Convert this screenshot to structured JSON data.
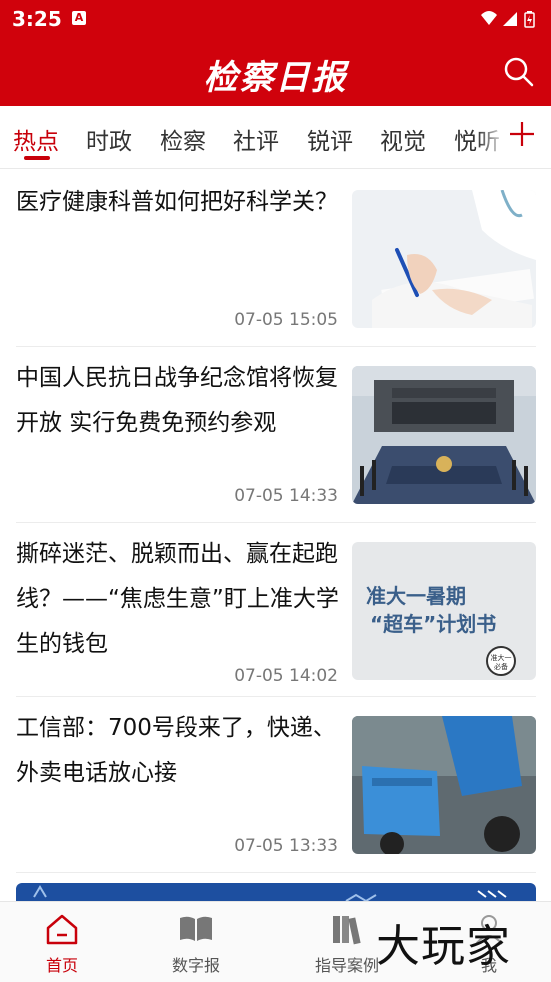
{
  "status_bar": {
    "time": "3:25",
    "notification_icon": "app-notification-icon"
  },
  "header": {
    "logo_text": "检察日报",
    "search_icon": "search-icon"
  },
  "tabs": [
    {
      "label": "热点",
      "active": true
    },
    {
      "label": "时政"
    },
    {
      "label": "检察"
    },
    {
      "label": "社评"
    },
    {
      "label": "锐评"
    },
    {
      "label": "视觉"
    },
    {
      "label": "悦听"
    }
  ],
  "news": [
    {
      "title": "医疗健康科普如何把好科学关？",
      "time": "07-05 15:05",
      "thumb": "doctor-writing-photo"
    },
    {
      "title": "中国人民抗日战争纪念馆将恢复开放 实行免费免预约参观",
      "time": "07-05 14:33",
      "thumb": "memorial-hall-photo"
    },
    {
      "title": "撕碎迷茫、脱颖而出、赢在起跑线？——“焦虑生意”盯上准大学生的钱包",
      "time": "07-05 14:02",
      "thumb": "poster-image"
    },
    {
      "title": "工信部：700号段来了，快递、外卖电话放心接",
      "time": "07-05 13:33",
      "thumb": "delivery-rider-photo"
    }
  ],
  "poster": {
    "line1": "准大一暑期",
    "line2": "“超车”计划书",
    "badge": "准大一必备"
  },
  "bottom_nav": [
    {
      "label": "首页",
      "icon": "home-icon",
      "active": true
    },
    {
      "label": "数字报",
      "icon": "book-icon"
    },
    {
      "label": "指导案例",
      "icon": "books-icon"
    },
    {
      "label": "我",
      "icon": "user-icon"
    }
  ],
  "watermark": "大玩家",
  "colors": {
    "brand_red": "#d0020c",
    "active_red": "#c8000a",
    "banner_blue": "#1d4fa0"
  }
}
